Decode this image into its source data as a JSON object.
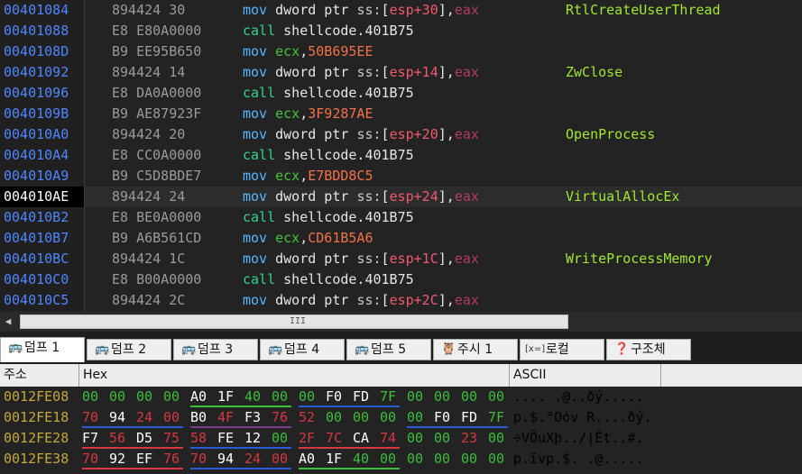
{
  "disassembly": {
    "rows": [
      {
        "address": "00401084",
        "bytes": "894424 30",
        "mnemonic": "mov",
        "parts": [
          [
            "op",
            "dword ptr "
          ],
          [
            "ss",
            "ss:"
          ],
          [
            "br",
            "["
          ],
          [
            "reg",
            "esp+30"
          ],
          [
            "br",
            "]"
          ],
          [
            "op",
            ","
          ],
          [
            "eax",
            "eax"
          ]
        ],
        "comment": "RtlCreateUserThread"
      },
      {
        "address": "00401088",
        "bytes": "E8 E80A0000",
        "mnemonic": "call",
        "parts": [
          [
            "op",
            "shellcode.401B75"
          ]
        ],
        "comment": ""
      },
      {
        "address": "0040108D",
        "bytes": "B9 EE95B650",
        "mnemonic": "mov",
        "parts": [
          [
            "reg-ecx",
            "ecx"
          ],
          [
            "op",
            ","
          ],
          [
            "imm",
            "50B695EE"
          ]
        ],
        "comment": ""
      },
      {
        "address": "00401092",
        "bytes": "894424 14",
        "mnemonic": "mov",
        "parts": [
          [
            "op",
            "dword ptr "
          ],
          [
            "ss",
            "ss:"
          ],
          [
            "br",
            "["
          ],
          [
            "reg",
            "esp+14"
          ],
          [
            "br",
            "]"
          ],
          [
            "op",
            ","
          ],
          [
            "eax",
            "eax"
          ]
        ],
        "comment": "ZwClose"
      },
      {
        "address": "00401096",
        "bytes": "E8 DA0A0000",
        "mnemonic": "call",
        "parts": [
          [
            "op",
            "shellcode.401B75"
          ]
        ],
        "comment": ""
      },
      {
        "address": "0040109B",
        "bytes": "B9 AE87923F",
        "mnemonic": "mov",
        "parts": [
          [
            "reg-ecx",
            "ecx"
          ],
          [
            "op",
            ","
          ],
          [
            "imm",
            "3F9287AE"
          ]
        ],
        "comment": ""
      },
      {
        "address": "004010A0",
        "bytes": "894424 20",
        "mnemonic": "mov",
        "parts": [
          [
            "op",
            "dword ptr "
          ],
          [
            "ss",
            "ss:"
          ],
          [
            "br",
            "["
          ],
          [
            "reg",
            "esp+20"
          ],
          [
            "br",
            "]"
          ],
          [
            "op",
            ","
          ],
          [
            "eax",
            "eax"
          ]
        ],
        "comment": "OpenProcess"
      },
      {
        "address": "004010A4",
        "bytes": "E8 CC0A0000",
        "mnemonic": "call",
        "parts": [
          [
            "op",
            "shellcode.401B75"
          ]
        ],
        "comment": ""
      },
      {
        "address": "004010A9",
        "bytes": "B9 C5D8BDE7",
        "mnemonic": "mov",
        "parts": [
          [
            "reg-ecx",
            "ecx"
          ],
          [
            "op",
            ","
          ],
          [
            "imm",
            "E7BDD8C5"
          ]
        ],
        "comment": ""
      },
      {
        "address": "004010AE",
        "bytes": "894424 24",
        "mnemonic": "mov",
        "parts": [
          [
            "op",
            "dword ptr "
          ],
          [
            "ss",
            "ss:"
          ],
          [
            "br",
            "["
          ],
          [
            "reg",
            "esp+24"
          ],
          [
            "br",
            "]"
          ],
          [
            "op",
            ","
          ],
          [
            "eax",
            "eax"
          ]
        ],
        "comment": "VirtualAllocEx",
        "selected": true
      },
      {
        "address": "004010B2",
        "bytes": "E8 BE0A0000",
        "mnemonic": "call",
        "parts": [
          [
            "op",
            "shellcode.401B75"
          ]
        ],
        "comment": ""
      },
      {
        "address": "004010B7",
        "bytes": "B9 A6B561CD",
        "mnemonic": "mov",
        "parts": [
          [
            "reg-ecx",
            "ecx"
          ],
          [
            "op",
            ","
          ],
          [
            "imm",
            "CD61B5A6"
          ]
        ],
        "comment": ""
      },
      {
        "address": "004010BC",
        "bytes": "894424 1C",
        "mnemonic": "mov",
        "parts": [
          [
            "op",
            "dword ptr "
          ],
          [
            "ss",
            "ss:"
          ],
          [
            "br",
            "["
          ],
          [
            "reg",
            "esp+1C"
          ],
          [
            "br",
            "]"
          ],
          [
            "op",
            ","
          ],
          [
            "eax",
            "eax"
          ]
        ],
        "comment": "WriteProcessMemory"
      },
      {
        "address": "004010C0",
        "bytes": "E8 B00A0000",
        "mnemonic": "call",
        "parts": [
          [
            "op",
            "shellcode.401B75"
          ]
        ],
        "comment": ""
      },
      {
        "address": "004010C5",
        "bytes": "894424 2C",
        "mnemonic": "mov",
        "parts": [
          [
            "op",
            "dword ptr "
          ],
          [
            "ss",
            "ss:"
          ],
          [
            "br",
            "["
          ],
          [
            "reg",
            "esp+2C"
          ],
          [
            "br",
            "]"
          ],
          [
            "op",
            ","
          ],
          [
            "eax",
            "eax"
          ]
        ],
        "comment": ""
      }
    ]
  },
  "scrollbar": {
    "left_arrow": "◀",
    "grip": "III"
  },
  "tabs": [
    {
      "icon": "dump-icon",
      "label": "덤프 1",
      "active": true
    },
    {
      "icon": "dump-icon",
      "label": "덤프 2"
    },
    {
      "icon": "dump-icon",
      "label": "덤프 3"
    },
    {
      "icon": "dump-icon",
      "label": "덤프 4"
    },
    {
      "icon": "dump-icon",
      "label": "덤프 5"
    },
    {
      "icon": "watch-icon",
      "label": "주시 1"
    },
    {
      "icon": "locals-icon",
      "label": "로컬",
      "icon_text": "[x=]"
    },
    {
      "icon": "struct-icon",
      "label": "구조체"
    }
  ],
  "hex_view": {
    "headers": {
      "address": "주소",
      "hex": "Hex",
      "ascii": "ASCII"
    },
    "rows": [
      {
        "address": "0012FE08",
        "groups": [
          {
            "bytes": [
              "00",
              "00",
              "00",
              "00"
            ],
            "colors": [
              "green",
              "green",
              "green",
              "green"
            ],
            "underline": ""
          },
          {
            "bytes": [
              "A0",
              "1F",
              "40",
              "00"
            ],
            "colors": [
              "white",
              "white",
              "green",
              "green"
            ],
            "underline": "green"
          },
          {
            "bytes": [
              "00",
              "F0",
              "FD",
              "7F"
            ],
            "colors": [
              "green",
              "white",
              "white",
              "green"
            ],
            "underline": "blue"
          },
          {
            "bytes": [
              "00",
              "00",
              "00",
              "00"
            ],
            "colors": [
              "green",
              "green",
              "green",
              "green"
            ],
            "underline": ""
          }
        ],
        "ascii": ".... .@..ðý....."
      },
      {
        "address": "0012FE18",
        "groups": [
          {
            "bytes": [
              "70",
              "94",
              "24",
              "00"
            ],
            "colors": [
              "red",
              "white",
              "red",
              "red"
            ],
            "underline": "blue"
          },
          {
            "bytes": [
              "B0",
              "4F",
              "F3",
              "76"
            ],
            "colors": [
              "white",
              "red",
              "white",
              "red"
            ],
            "underline": "purple"
          },
          {
            "bytes": [
              "52",
              "00",
              "00",
              "00"
            ],
            "colors": [
              "red",
              "green",
              "green",
              "green"
            ],
            "underline": ""
          },
          {
            "bytes": [
              "00",
              "F0",
              "FD",
              "7F"
            ],
            "colors": [
              "green",
              "white",
              "white",
              "green"
            ],
            "underline": "blue"
          }
        ],
        "ascii": "p.$.°Oóv R....ðý."
      },
      {
        "address": "0012FE28",
        "groups": [
          {
            "bytes": [
              "F7",
              "56",
              "D5",
              "75"
            ],
            "colors": [
              "white",
              "red",
              "white",
              "red"
            ],
            "underline": "red"
          },
          {
            "bytes": [
              "58",
              "FE",
              "12",
              "00"
            ],
            "colors": [
              "red",
              "white",
              "white",
              "green"
            ],
            "underline": "blue"
          },
          {
            "bytes": [
              "2F",
              "7C",
              "CA",
              "74"
            ],
            "colors": [
              "red",
              "red",
              "white",
              "red"
            ],
            "underline": "red"
          },
          {
            "bytes": [
              "00",
              "00",
              "23",
              "00"
            ],
            "colors": [
              "green",
              "green",
              "red",
              "green"
            ],
            "underline": ""
          }
        ],
        "ascii": "÷VÕuXþ../|Êt..#."
      },
      {
        "address": "0012FE38",
        "groups": [
          {
            "bytes": [
              "70",
              "92",
              "EF",
              "76"
            ],
            "colors": [
              "red",
              "white",
              "white",
              "red"
            ],
            "underline": "red"
          },
          {
            "bytes": [
              "70",
              "94",
              "24",
              "00"
            ],
            "colors": [
              "red",
              "white",
              "red",
              "red"
            ],
            "underline": "blue"
          },
          {
            "bytes": [
              "A0",
              "1F",
              "40",
              "00"
            ],
            "colors": [
              "white",
              "white",
              "green",
              "green"
            ],
            "underline": "green"
          },
          {
            "bytes": [
              "00",
              "00",
              "00",
              "00"
            ],
            "colors": [
              "green",
              "green",
              "green",
              "green"
            ],
            "underline": ""
          }
        ],
        "ascii": "p.ïvp.$. .@....."
      }
    ]
  },
  "colors": {
    "address": "#4f86ff",
    "mnemonic_mov": "#55b6ff",
    "mnemonic_call": "#31d48c",
    "comment": "#a0e830",
    "hex_address": "#c4a83a",
    "underline_blue": "#2a5bd6",
    "underline_red": "#d53840",
    "underline_green": "#3bbf3b",
    "underline_purple": "#7a3b8a"
  }
}
